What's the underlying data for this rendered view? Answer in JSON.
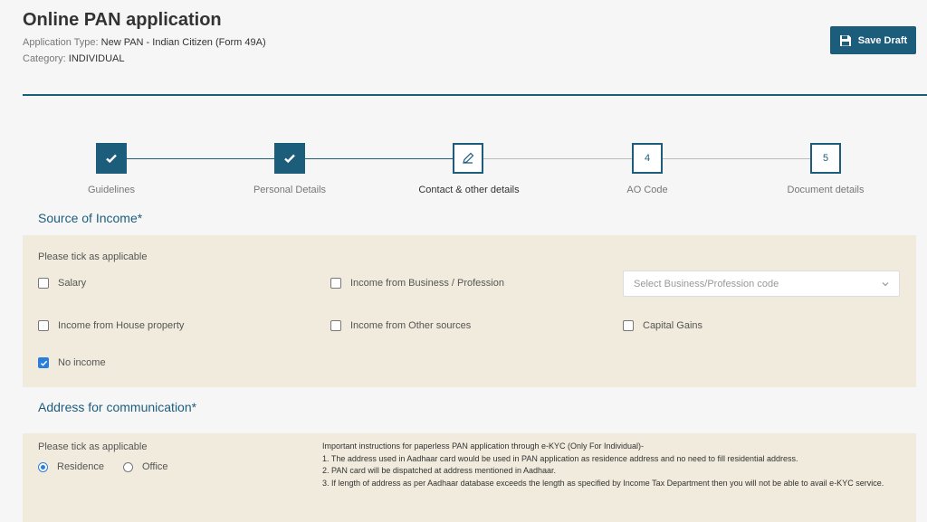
{
  "header": {
    "title": "Online PAN application",
    "application_type_label": "Application Type:",
    "application_type_value": "New PAN - Indian Citizen (Form 49A)",
    "category_label": "Category:",
    "category_value": "INDIVIDUAL",
    "save_draft_label": "Save Draft"
  },
  "stepper": {
    "steps": [
      {
        "label": "Guidelines",
        "state": "done",
        "marker": ""
      },
      {
        "label": "Personal Details",
        "state": "done",
        "marker": ""
      },
      {
        "label": "Contact & other details",
        "state": "current",
        "marker": ""
      },
      {
        "label": "AO Code",
        "state": "todo",
        "marker": "4"
      },
      {
        "label": "Document details",
        "state": "todo",
        "marker": "5"
      }
    ]
  },
  "income": {
    "title": "Source of Income*",
    "hint": "Please tick as applicable",
    "options": {
      "salary": {
        "label": "Salary",
        "checked": false
      },
      "business": {
        "label": "Income from Business / Profession",
        "checked": false
      },
      "house": {
        "label": "Income from House property",
        "checked": false
      },
      "other": {
        "label": "Income from Other sources",
        "checked": false
      },
      "capital": {
        "label": "Capital Gains",
        "checked": false
      },
      "none": {
        "label": "No income",
        "checked": true
      }
    },
    "business_code_placeholder": "Select Business/Profession code"
  },
  "address": {
    "title": "Address for communication*",
    "hint": "Please tick as applicable",
    "residence_label": "Residence",
    "office_label": "Office",
    "selected": "residence",
    "instructions": {
      "heading": "Important instructions for paperless PAN application through e-KYC (Only For Individual)-",
      "line1": "1. The address used in Aadhaar card would be used in PAN application as residence address and no need to fill residential address.",
      "line2": "2. PAN card will be dispatched at address mentioned in Aadhaar.",
      "line3": "3. If length of address as per Aadhaar database exceeds the length as specified by Income Tax Department then you will not be able to avail e-KYC service."
    }
  },
  "colors": {
    "primary": "#1d5d7c",
    "panel": "#f0ebdc",
    "checkbox_checked": "#2b7fdc"
  }
}
